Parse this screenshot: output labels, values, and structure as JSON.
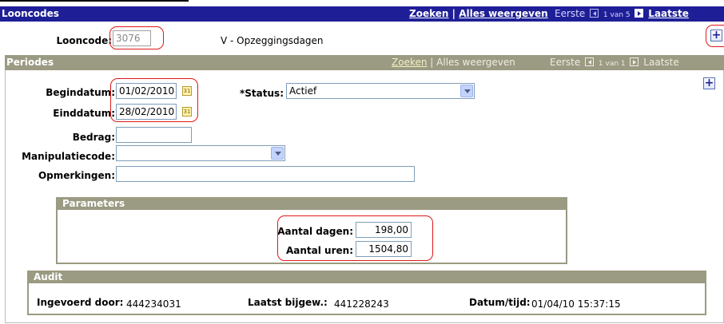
{
  "looncodes": {
    "title": "Looncodes",
    "zoeken": "Zoeken",
    "separator": "|",
    "alles": "Alles weergeven",
    "eerste": "Eerste",
    "range": "1 van 5",
    "laatste": "Laatste",
    "looncode_label": "Looncode:",
    "looncode_value": "3076",
    "looncode_desc": "V - Opzeggingsdagen"
  },
  "periodes": {
    "title": "Periodes",
    "zoeken": "Zoeken",
    "separator": "|",
    "alles": "Alles weergeven",
    "eerste": "Eerste",
    "range": "1 van 1",
    "laatste": "Laatste",
    "begindatum_label": "Begindatum:",
    "begindatum_value": "01/02/2010",
    "einddatum_label": "Einddatum:",
    "einddatum_value": "28/02/2010",
    "status_label": "*Status:",
    "status_value": "Actief",
    "bedrag_label": "Bedrag:",
    "bedrag_value": "",
    "manipulatiecode_label": "Manipulatiecode:",
    "manipulatiecode_value": "",
    "opmerkingen_label": "Opmerkingen:",
    "opmerkingen_value": ""
  },
  "parameters": {
    "title": "Parameters",
    "aantal_dagen_label": "Aantal dagen:",
    "aantal_dagen_value": "198,00",
    "aantal_uren_label": "Aantal uren:",
    "aantal_uren_value": "1504,80"
  },
  "audit": {
    "title": "Audit",
    "ingevoerd_label": "Ingevoerd door:",
    "ingevoerd_value": "444234031",
    "laatst_label": "Laatst bijgew.:",
    "laatst_value": "441228243",
    "datum_label": "Datum/tijd:",
    "datum_value": "01/04/10 15:37:15"
  },
  "icons": {
    "calendar_glyph": "31",
    "plus_glyph": "+"
  },
  "colors": {
    "header_blue": "#1e1f96",
    "section_tan": "#9b9a82",
    "highlight_red": "#e01818"
  }
}
